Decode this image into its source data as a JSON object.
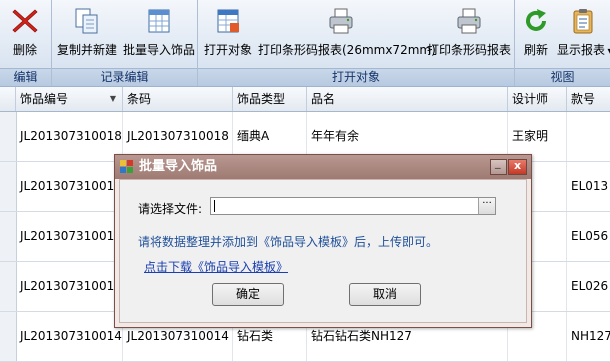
{
  "ribbon": {
    "groups": [
      {
        "caption": "编辑",
        "buttons": [
          {
            "label": "删除",
            "icon": "delete-x-icon"
          }
        ]
      },
      {
        "caption": "记录编辑",
        "buttons": [
          {
            "label": "复制并新建",
            "icon": "copy-documents-icon"
          },
          {
            "label": "批量导入饰品",
            "icon": "spreadsheet-import-icon"
          }
        ]
      },
      {
        "caption": "打开对象",
        "buttons": [
          {
            "label": "打开对象",
            "icon": "open-table-icon"
          },
          {
            "label": "打印条形码报表(26mmx72mm)",
            "icon": "printer-icon"
          },
          {
            "label": "打印条形码报表",
            "icon": "printer-icon"
          }
        ]
      },
      {
        "caption": "视图",
        "buttons": [
          {
            "label": "刷新",
            "icon": "refresh-icon"
          },
          {
            "label": "显示报表",
            "icon": "clipboard-report-icon"
          }
        ]
      }
    ]
  },
  "grid": {
    "columns": [
      "饰品编号",
      "条码",
      "饰品类型",
      "品名",
      "设计师",
      "款号"
    ],
    "rows": [
      [
        "JL201307310018",
        "JL201307310018",
        "缅典A",
        "年年有余",
        "王家明",
        ""
      ],
      [
        "JL201307310017",
        "",
        "",
        "",
        "",
        "EL013"
      ],
      [
        "JL201307310016",
        "",
        "",
        "",
        "",
        "EL056"
      ],
      [
        "JL201307310015",
        "",
        "",
        "",
        "",
        "EL026"
      ],
      [
        "JL201307310014",
        "JL201307310014",
        "钻石类",
        "钻石钻石类NH127",
        "",
        "NH127"
      ]
    ]
  },
  "dialog": {
    "title": "批量导入饰品",
    "file_label": "请选择文件:",
    "file_value": "",
    "browse_label": "···",
    "hint": "请将数据整理并添加到《饰品导入模板》后，上传即可。",
    "download_link": "点击下载《饰品导入模板》",
    "ok_label": "确定",
    "cancel_label": "取消",
    "minimize_label": "_",
    "close_label": "x"
  }
}
